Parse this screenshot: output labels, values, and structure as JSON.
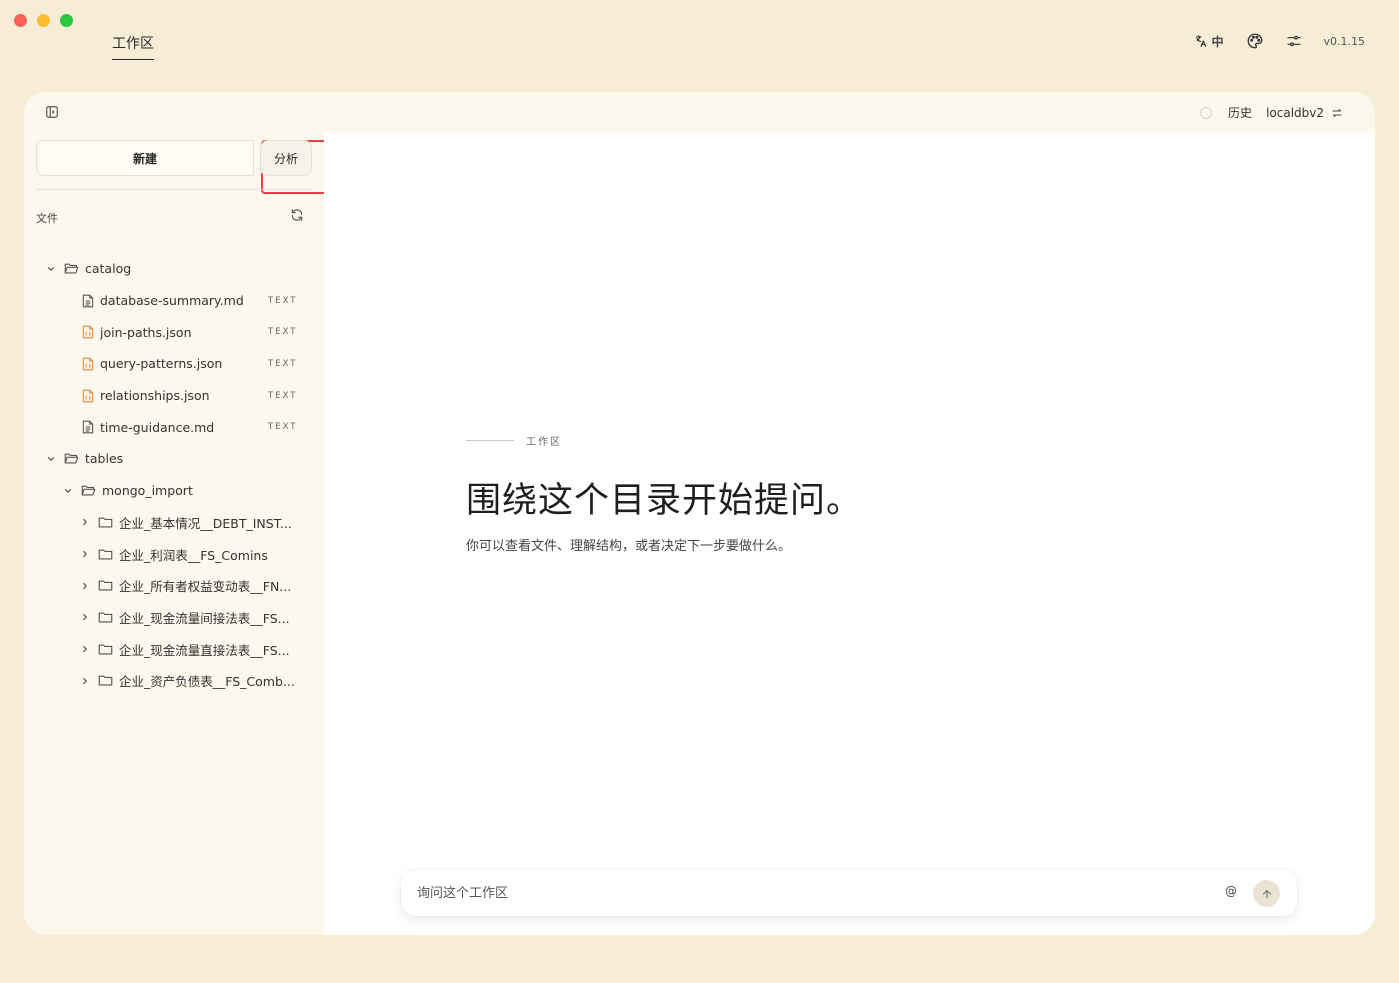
{
  "app": {
    "tab_label": "工作区",
    "language_label": "中",
    "version": "v0.1.15"
  },
  "header": {
    "history_label": "历史",
    "database_label": "localdbv2"
  },
  "sidebar": {
    "new_button": "新建",
    "analyze_button": "分析",
    "files_label": "文件",
    "tree": [
      {
        "type": "folder",
        "label": "catalog",
        "level": 0,
        "expanded": true
      },
      {
        "type": "file",
        "label": "database-summary.md",
        "level": 1,
        "kind": "md",
        "tag": "TEXT"
      },
      {
        "type": "file",
        "label": "join-paths.json",
        "level": 1,
        "kind": "json",
        "tag": "TEXT"
      },
      {
        "type": "file",
        "label": "query-patterns.json",
        "level": 1,
        "kind": "json",
        "tag": "TEXT"
      },
      {
        "type": "file",
        "label": "relationships.json",
        "level": 1,
        "kind": "json",
        "tag": "TEXT"
      },
      {
        "type": "file",
        "label": "time-guidance.md",
        "level": 1,
        "kind": "md",
        "tag": "TEXT"
      },
      {
        "type": "folder",
        "label": "tables",
        "level": 0,
        "expanded": true
      },
      {
        "type": "folder",
        "label": "mongo_import",
        "level": 1,
        "expanded": true
      },
      {
        "type": "folder",
        "label": "企业_基本情况__DEBT_INST...",
        "level": 2,
        "expanded": false
      },
      {
        "type": "folder",
        "label": "企业_利润表__FS_Comins",
        "level": 2,
        "expanded": false
      },
      {
        "type": "folder",
        "label": "企业_所有者权益变动表__FN...",
        "level": 2,
        "expanded": false
      },
      {
        "type": "folder",
        "label": "企业_现金流量间接法表__FS...",
        "level": 2,
        "expanded": false
      },
      {
        "type": "folder",
        "label": "企业_现金流量直接法表__FS...",
        "level": 2,
        "expanded": false
      },
      {
        "type": "folder",
        "label": "企业_资产负债表__FS_Comb...",
        "level": 2,
        "expanded": false
      }
    ]
  },
  "main": {
    "eyebrow": "工作区",
    "headline": "围绕这个目录开始提问。",
    "subline": "你可以查看文件、理解结构，或者决定下一步要做什么。"
  },
  "chat": {
    "placeholder": "询问这个工作区",
    "mention_symbol": "@"
  },
  "colors": {
    "background": "#f7ecd6",
    "sidebar": "#fdf8ee",
    "highlight_box": "#e64040",
    "json_icon": "#e8883a"
  }
}
